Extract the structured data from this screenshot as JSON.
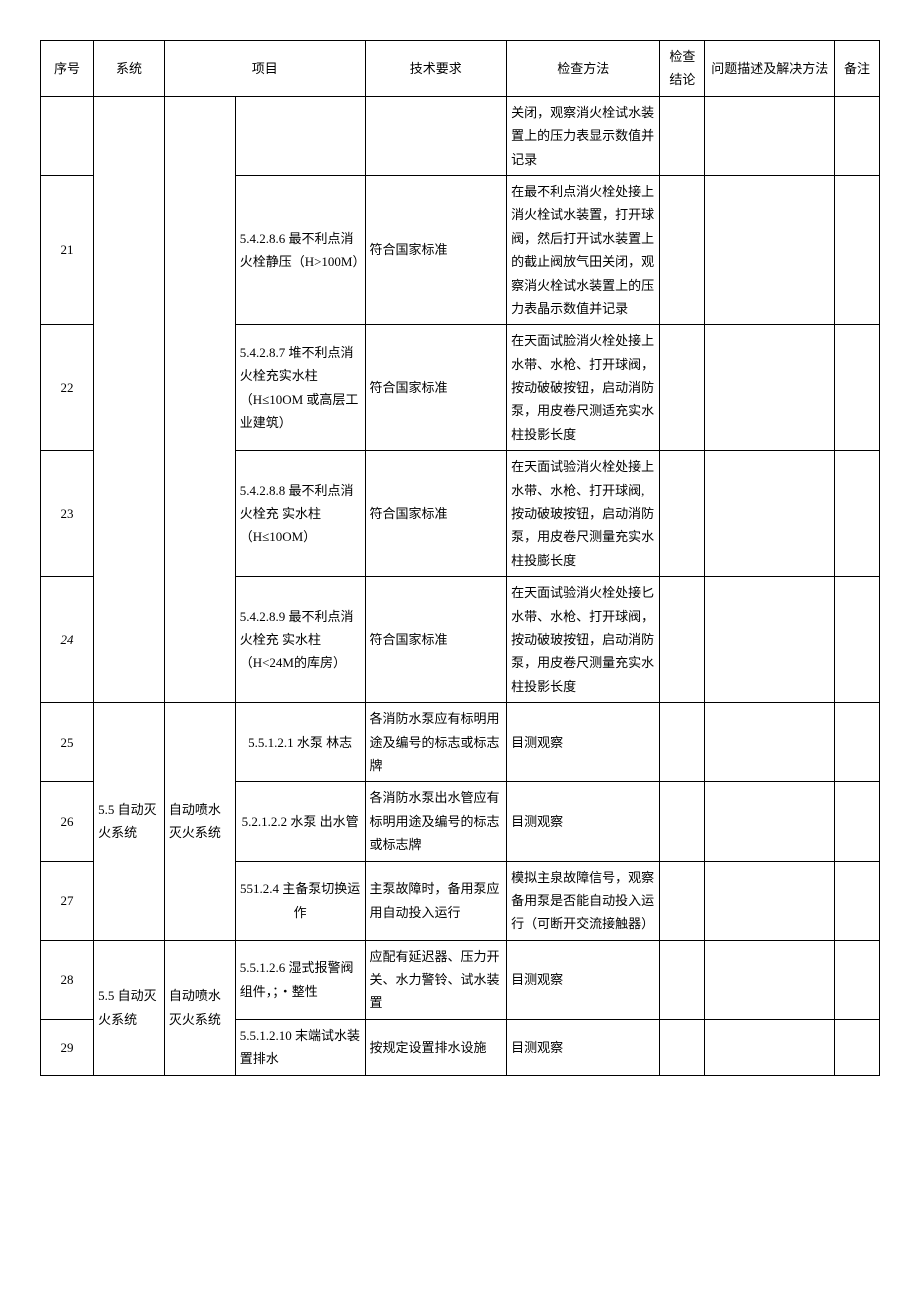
{
  "headers": {
    "seq": "序号",
    "sys": "系统",
    "item": "项目",
    "req": "技术要求",
    "method": "检查方法",
    "result": "检查结论",
    "desc": "问题描述及解决方法",
    "note": "备注"
  },
  "rows": {
    "r20": {
      "method": "关闭，观察消火栓试水装置上的压力表显示数值并记录"
    },
    "r21": {
      "seq": "21",
      "item": "5.4.2.8.6 最不利点消火栓静压（H>100M）",
      "req": "符合国家标准",
      "method": "在最不利点消火栓处接上消火栓试水装置，打开球阀，然后打开试水装置上的截止阀放气田关闭，观察消火栓试水装置上的压力表晶示数值并记录"
    },
    "r22": {
      "seq": "22",
      "item": "5.4.2.8.7 堆不利点消火栓充实水柱（H≤10OM 或高层工业建筑）",
      "req": "符合国家标准",
      "method": "在天面试脸消火栓处接上水带、水枪、打开球阀，按动破破按钮，启动消防泵，用皮卷尺测适充实水柱投影长度"
    },
    "r23": {
      "seq": "23",
      "item": "5.4.2.8.8 最不利点消火栓充\n实水柱（H≤10OM）",
      "req": "符合国家标准",
      "method": "在天面试验消火栓处接上水带、水枪、打开球阀, 按动破玻按钮，启动消防泵，用皮卷尺测量充实水柱投膨长度"
    },
    "r24": {
      "seq": "24",
      "item": "5.4.2.8.9 最不利点消火栓充\n实水柱（H<24M的库房）",
      "req": "符合国家标准",
      "method": "在天面试验消火栓处接匕水带、水枪、打开球阀，按动破玻按钮，启动消防泵，用皮卷尺测量充实水柱投影长度"
    },
    "r25": {
      "seq": "25",
      "sys": "5.5 自动灭火系统",
      "sub": "自动喷水灭火系统",
      "item": "5.5.1.2.1 水泵\n林志",
      "req": "各消防水泵应有标明用途及编号的标志或标志牌",
      "method": "目测观察"
    },
    "r26": {
      "seq": "26",
      "item": "5.2.1.2.2 水泵\n出水管",
      "req": "各消防水泵出水管应有标明用途及编号的标志或标志牌",
      "method": "目测观察"
    },
    "r27": {
      "seq": "27",
      "item": "551.2.4 主备泵切换运作",
      "req": "主泵故障时，备用泵应用自动投入运行",
      "method": "模拟主泉故障信号，观察备用泵是否能自动投入运行（可断开交流接触器）"
    },
    "r28": {
      "seq": "28",
      "sys": "5.5 自动灭火系统",
      "sub": "自动喷水灭火系统",
      "item": "5.5.1.2.6 湿式报警阀组件，；・整性",
      "req": "应配有延迟器、压力开关、水力警铃、试水装置",
      "method": "目测观察"
    },
    "r29": {
      "seq": "29",
      "item": "5.5.1.2.10 末端试水装置排水",
      "req": "按规定设置排水设施",
      "method": "目测观察"
    }
  }
}
